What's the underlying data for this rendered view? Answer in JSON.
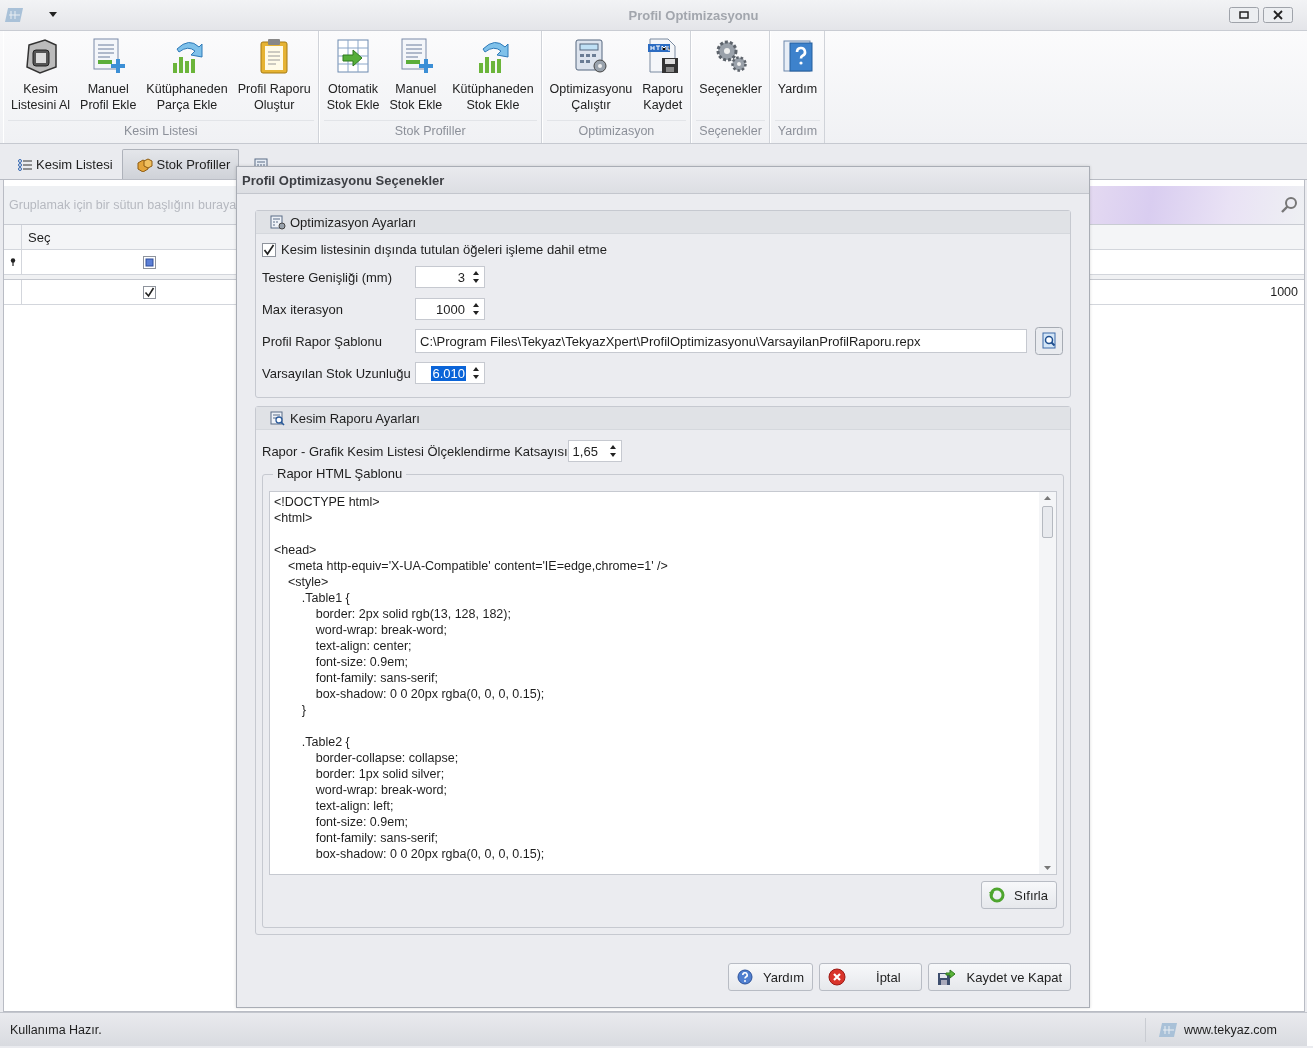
{
  "window": {
    "title": "Profil Optimizasyonu"
  },
  "ribbon": {
    "groups": [
      {
        "title": "Kesim Listesi",
        "items": [
          {
            "label_lines": [
              "Kesim",
              "Listesini Al"
            ]
          },
          {
            "label_lines": [
              "Manuel",
              "Profil Ekle"
            ]
          },
          {
            "label_lines": [
              "Kütüphaneden",
              "Parça Ekle"
            ]
          },
          {
            "label_lines": [
              "Profil Raporu",
              "Oluştur"
            ]
          }
        ]
      },
      {
        "title": "Stok Profiller",
        "items": [
          {
            "label_lines": [
              "Otomatik",
              "Stok Ekle"
            ]
          },
          {
            "label_lines": [
              "Manuel",
              "Stok Ekle"
            ]
          },
          {
            "label_lines": [
              "Kütüphaneden",
              "Stok Ekle"
            ]
          }
        ]
      },
      {
        "title": "Optimizasyon",
        "items": [
          {
            "label_lines": [
              "Optimizasyonu",
              "Çalıştır"
            ]
          },
          {
            "label_lines": [
              "Raporu",
              "Kaydet"
            ]
          }
        ]
      },
      {
        "title": "Seçenekler",
        "items": [
          {
            "label_lines": [
              "Seçenekler"
            ]
          }
        ]
      },
      {
        "title": "Yardım",
        "items": [
          {
            "label_lines": [
              "Yardım"
            ]
          }
        ]
      }
    ]
  },
  "tabs": [
    {
      "label": "Kesim Listesi",
      "selected": false
    },
    {
      "label": "Stok Profiller",
      "selected": true
    },
    {
      "selected": false
    }
  ],
  "grid": {
    "group_panel_hint": "Gruplamak için bir sütun başlığını buraya",
    "columns": [
      "Seç"
    ],
    "rows": [
      {
        "new_row": true,
        "checked": false,
        "indeterminate": true
      },
      {
        "new_row": false,
        "checked": true,
        "indeterminate": false,
        "column_2": "1000"
      }
    ]
  },
  "dialog": {
    "title": "Profil Optimizasyonu Seçenekler",
    "optimization": {
      "title": "Optimizasyon Ayarları",
      "checkbox": {
        "label": "Kesim listesinin dışında tutulan öğeleri işleme dahil etme",
        "checked": true
      },
      "fields": [
        {
          "kind": "spin",
          "label": "Testere Genişliği (mm)",
          "value": "3",
          "text_selected": false
        },
        {
          "kind": "spin",
          "label": "Max iterasyon",
          "value": "1000",
          "text_selected": false
        },
        {
          "kind": "path",
          "label": "Profil Rapor Şablonu",
          "value": "C:\\Program Files\\Tekyaz\\TekyazXpert\\ProfilOptimizasyonu\\VarsayilanProfilRaporu.repx",
          "text_selected": false
        },
        {
          "kind": "spin",
          "label": "Varsayılan Stok Uzunluğu",
          "value": "6.010",
          "text_selected": true
        }
      ]
    },
    "report": {
      "title": "Kesim Raporu Ayarları",
      "scale": {
        "label": "Rapor - Grafik Kesim Listesi Ölçeklendirme Katsayısı",
        "value": "1,65"
      },
      "template": {
        "title": "Rapor HTML Şablonu",
        "text": "<!DOCTYPE html>\n<html>\n\n<head>\n    <meta http-equiv='X-UA-Compatible' content='IE=edge,chrome=1' />\n    <style>\n        .Table1 {\n            border: 2px solid rgb(13, 128, 182);\n            word-wrap: break-word;\n            text-align: center;\n            font-size: 0.9em;\n            font-family: sans-serif;\n            box-shadow: 0 0 20px rgba(0, 0, 0, 0.15);\n        }\n\n        .Table2 {\n            border-collapse: collapse;\n            border: 1px solid silver;\n            word-wrap: break-word;\n            text-align: left;\n            font-size: 0.9em;\n            font-family: sans-serif;\n            box-shadow: 0 0 20px rgba(0, 0, 0, 0.15);",
        "reset_button": "Sıfırla"
      }
    },
    "buttons": [
      {
        "kind": "help",
        "label": "Yardım"
      },
      {
        "kind": "cancel",
        "label": "İptal"
      },
      {
        "kind": "save",
        "label": "Kaydet ve Kapat"
      }
    ]
  },
  "status_bar": {
    "message": "Kullanıma Hazır.",
    "website": "www.tekyaz.com"
  }
}
